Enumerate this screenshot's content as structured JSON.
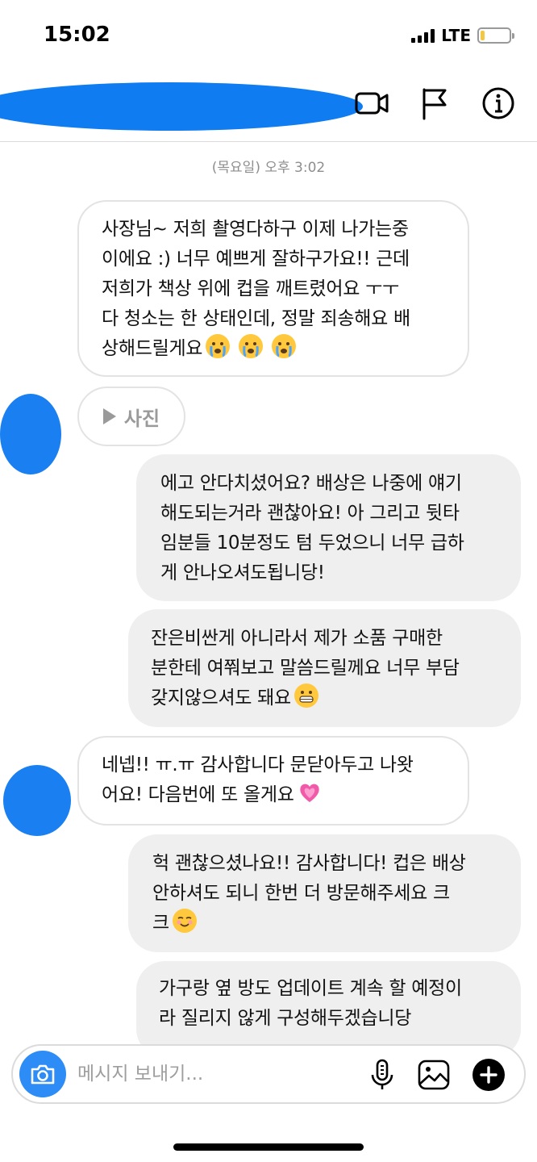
{
  "status_bar": {
    "time": "15:02",
    "network": "LTE",
    "battery_level": 0.15
  },
  "header": {
    "icons": [
      "video-call-icon",
      "flag-icon",
      "info-icon"
    ]
  },
  "timestamp": "(목요일) 오후 3:02",
  "messages": [
    {
      "side": "in",
      "lines": [
        "사장님~ 저희 촬영다하구 이제 나가는중",
        "이에요 :) 너무 예쁘게 잘하구가요!! 근데",
        "저희가 책상 위에 컵을 깨트렸어요 ㅜㅜ",
        "다 청소는 한 상태인데, 정말 죄송해요 배",
        "상해드릴게요"
      ],
      "emoji": "😭 😭 😭"
    },
    {
      "side": "out",
      "lines": [
        "에고 안다치셨어요? 배상은 나중에 얘기",
        "해도되는거라 괜찮아요! 아 그리고 뒷타",
        "임분들 10분정도 텀 두었으니 너무 급하",
        "게 안나오셔도됩니당!"
      ]
    },
    {
      "side": "out",
      "lines": [
        "잔은비싼게 아니라서 제가 소품 구매한",
        "분한테 여쭤보고 말씀드릴께요 너무 부담",
        "갖지않으셔도 돼요"
      ],
      "emoji": "😬"
    },
    {
      "side": "in",
      "lines": [
        "네넵!! ㅠ.ㅠ 감사합니다 문닫아두고 나왓",
        "어요! 다음번에 또 올게요"
      ],
      "emoji": "💗"
    },
    {
      "side": "out",
      "lines": [
        "헉 괜찮으셨나요!! 감사합니다! 컵은 배상",
        "안하셔도 되니 한번 더 방문해주세요 크",
        "크"
      ],
      "emoji": "☺️"
    },
    {
      "side": "out",
      "lines": [
        "가구랑 옆 방도 업데이트 계속 할 예정이",
        "라 질리지 않게 구성해두겠습니당"
      ]
    }
  ],
  "photo_attachment": {
    "label": "사진"
  },
  "composer": {
    "placeholder": "메시지 보내기..."
  },
  "colors": {
    "accent": "#0f7cf1",
    "incoming_bubble_border": "#e3e3e3",
    "outgoing_bubble": "#efefef"
  }
}
